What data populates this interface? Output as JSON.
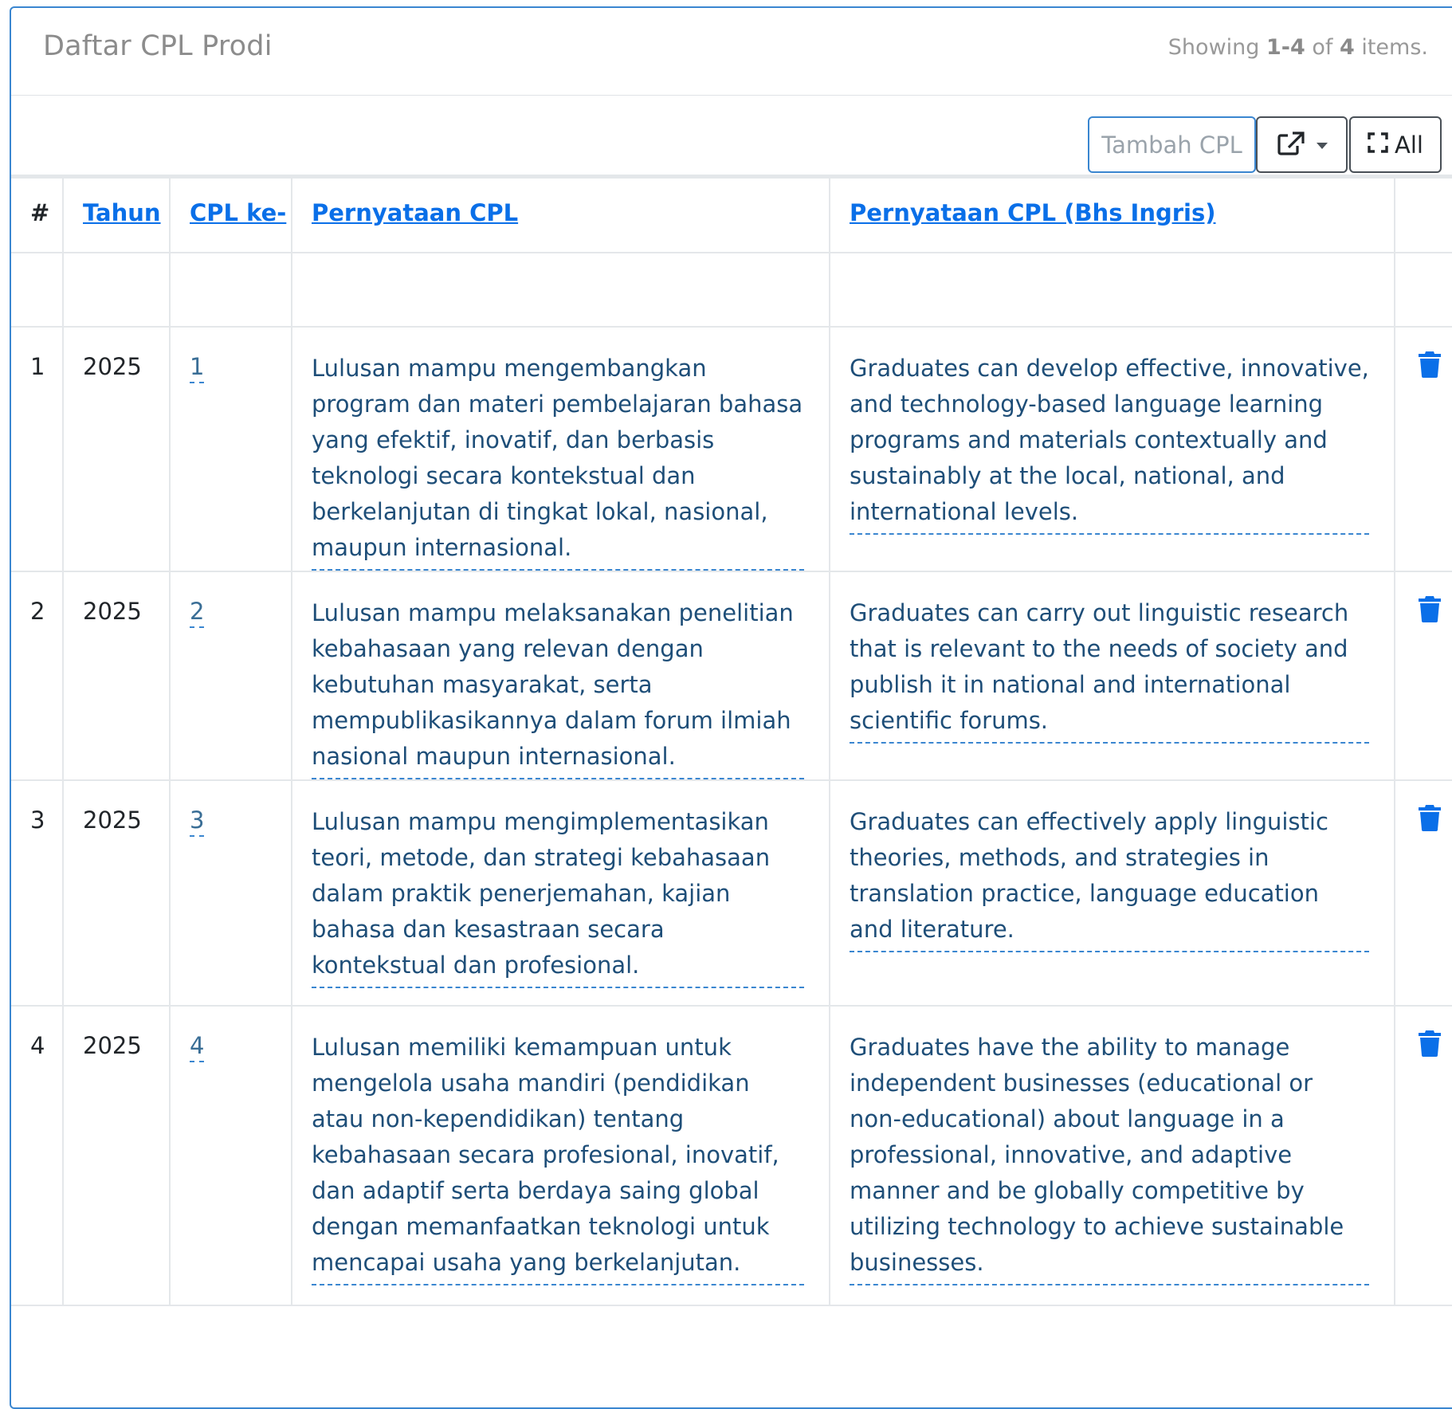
{
  "panel": {
    "title": "Daftar CPL Prodi",
    "summary": {
      "prefix": "Showing ",
      "range": "1-4",
      "middle": " of ",
      "total": "4",
      "suffix": " items."
    }
  },
  "toolbar": {
    "add_label": "Tambah CPL",
    "export_icon": "external-link-icon",
    "all_label": "All",
    "all_icon": "expand-icon"
  },
  "table": {
    "columns": {
      "no": "#",
      "year": "Tahun",
      "cpl_no": "CPL ke-",
      "statement": "Pernyataan CPL",
      "statement_en": "Pernyataan CPL (Bhs Ingris)"
    },
    "rows": [
      {
        "no": "1",
        "year": "2025",
        "cpl_no": "1",
        "statement": "Lulusan mampu mengembangkan program dan materi pembelajaran bahasa yang efektif, inovatif, dan berbasis teknologi secara kontekstual dan berkelanjutan di tingkat lokal, nasional, maupun internasional.",
        "statement_en": "Graduates can develop effective, innovative, and technology-based language learning programs and materials contextually and sustainably at the local, national, and international levels."
      },
      {
        "no": "2",
        "year": "2025",
        "cpl_no": "2",
        "statement": "Lulusan mampu melaksanakan penelitian kebahasaan yang relevan dengan kebutuhan masyarakat, serta mempublikasikannya dalam forum ilmiah nasional maupun internasional.",
        "statement_en": "Graduates can carry out linguistic research that is relevant to the needs of society and publish it in national and international scientific forums."
      },
      {
        "no": "3",
        "year": "2025",
        "cpl_no": "3",
        "statement": "Lulusan mampu mengimplementasikan teori, metode, dan strategi kebahasaan dalam praktik penerjemahan, kajian bahasa dan kesastraan secara kontekstual dan profesional.",
        "statement_en": "Graduates can effectively apply linguistic theories, methods, and strategies in translation practice, language education and literature."
      },
      {
        "no": "4",
        "year": "2025",
        "cpl_no": "4",
        "statement": "Lulusan memiliki kemampuan untuk mengelola usaha mandiri (pendidikan atau non-kependidikan) tentang kebahasaan secara profesional, inovatif, dan adaptif serta berdaya saing global dengan memanfaatkan teknologi untuk mencapai usaha yang berkelanjutan.",
        "statement_en": "Graduates have the ability to manage independent businesses (educational or non-educational) about language in a professional, innovative, and adaptive manner and be globally competitive by utilizing technology to achieve sustainable businesses."
      }
    ],
    "row_action_icon": "trash-icon"
  },
  "colors": {
    "accent": "#3a86d0",
    "link": "#0a6fe8",
    "delete": "#0a6fe8",
    "statement_text": "#1e4e78"
  }
}
